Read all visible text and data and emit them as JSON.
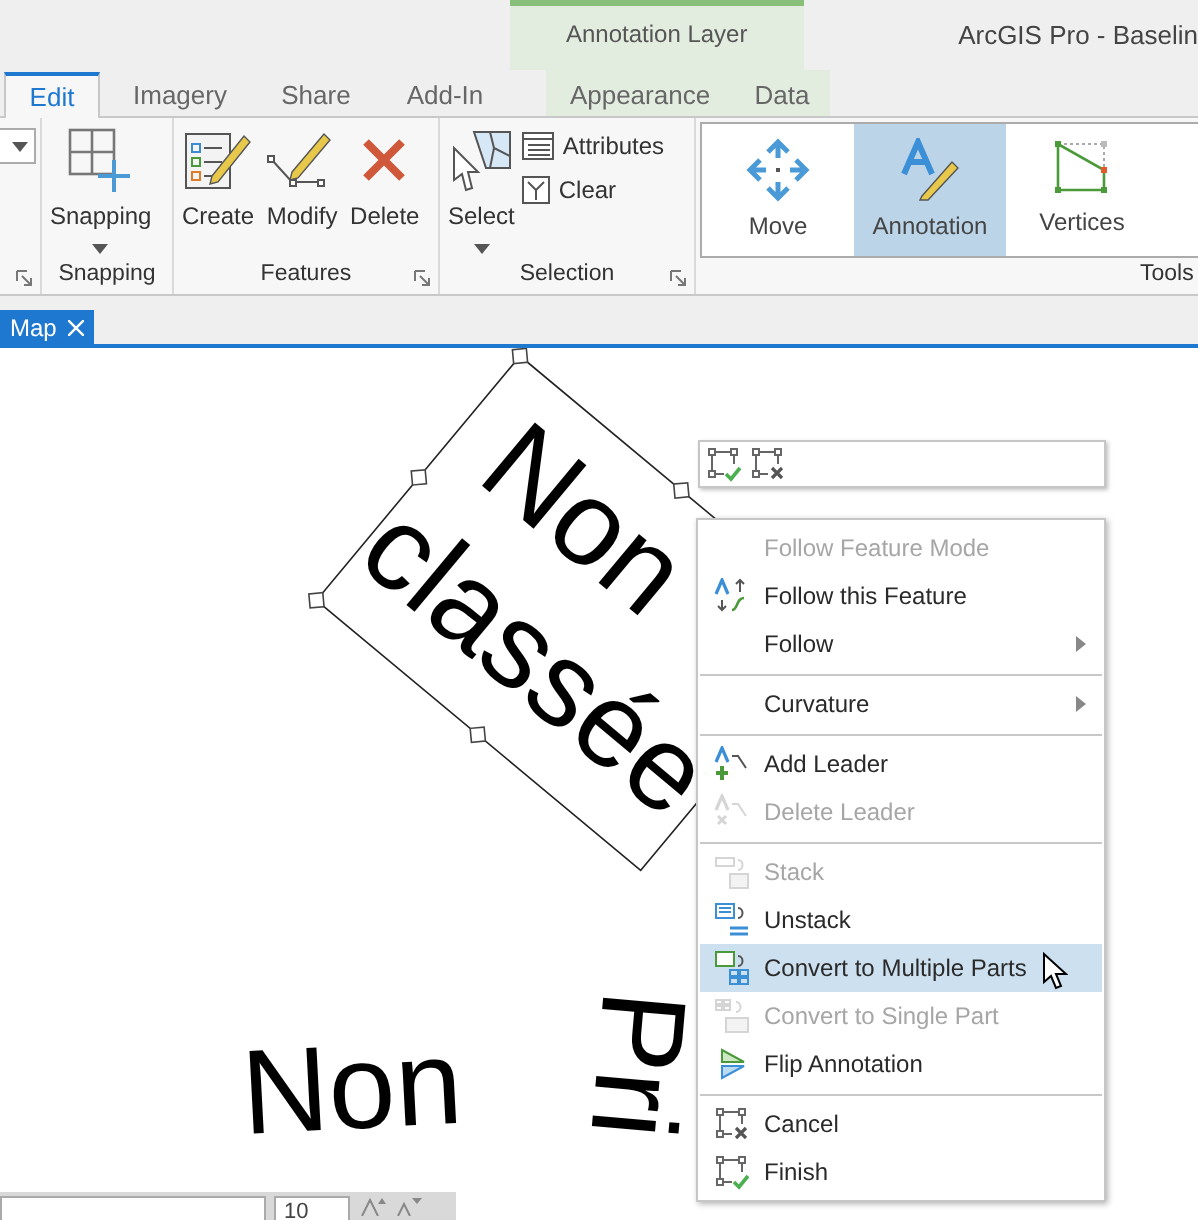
{
  "window": {
    "title": "ArcGIS Pro - Baselin"
  },
  "contextual_tab_group": {
    "label": "Annotation Layer"
  },
  "tabs": [
    {
      "label": "Edit",
      "selected": true,
      "contextual": false
    },
    {
      "label": "Imagery",
      "selected": false,
      "contextual": false
    },
    {
      "label": "Share",
      "selected": false,
      "contextual": false
    },
    {
      "label": "Add-In",
      "selected": false,
      "contextual": false
    },
    {
      "label": "Appearance",
      "selected": false,
      "contextual": true
    },
    {
      "label": "Data",
      "selected": false,
      "contextual": true
    }
  ],
  "ribbon_groups": [
    {
      "kind": "cut",
      "launcher": true,
      "buttons": [
        {
          "kind": "combo"
        }
      ]
    },
    {
      "kind": "group",
      "label": "Snapping",
      "launcher": false,
      "buttons": [
        {
          "kind": "large",
          "label": "Snapping",
          "dropdown": true
        }
      ]
    },
    {
      "kind": "group",
      "label": "Features",
      "launcher": true,
      "buttons": [
        {
          "kind": "large",
          "label": "Create",
          "dropdown": false
        },
        {
          "kind": "large",
          "label": "Modify",
          "dropdown": false
        },
        {
          "kind": "large",
          "label": "Delete",
          "dropdown": false
        }
      ]
    },
    {
      "kind": "group",
      "label": "Selection",
      "launcher": true,
      "buttons": [
        {
          "kind": "large",
          "label": "Select",
          "dropdown": true
        },
        {
          "kind": "small",
          "label": "Attributes"
        },
        {
          "kind": "small",
          "label": "Clear"
        }
      ]
    },
    {
      "kind": "gallery",
      "label": "Tools",
      "launcher": false,
      "buttons": [
        {
          "kind": "tile",
          "label": "Move",
          "selected": false
        },
        {
          "kind": "tile",
          "label": "Annotation",
          "selected": true
        },
        {
          "kind": "tile",
          "label": "Vertices",
          "selected": false
        }
      ]
    }
  ],
  "view_tabs": [
    {
      "label": "Map",
      "selected": true
    }
  ],
  "map": {
    "annotations": [
      {
        "lines": [
          "Non",
          "classée"
        ],
        "selected": true
      },
      {
        "lines": [
          "Non"
        ],
        "selected": false
      },
      {
        "lines": [
          "Pri"
        ],
        "selected": false
      }
    ]
  },
  "context_menu": [
    {
      "kind": "item",
      "label": "Follow Feature Mode",
      "disabled": true,
      "submenu": false,
      "selected": false
    },
    {
      "kind": "item",
      "label": "Follow this Feature",
      "disabled": false,
      "submenu": false,
      "selected": false
    },
    {
      "kind": "item",
      "label": "Follow",
      "disabled": false,
      "submenu": true,
      "selected": false
    },
    {
      "kind": "separator"
    },
    {
      "kind": "item",
      "label": "Curvature",
      "disabled": false,
      "submenu": true,
      "selected": false
    },
    {
      "kind": "separator"
    },
    {
      "kind": "item",
      "label": "Add Leader",
      "disabled": false,
      "submenu": false,
      "selected": false
    },
    {
      "kind": "item",
      "label": "Delete Leader",
      "disabled": true,
      "submenu": false,
      "selected": false
    },
    {
      "kind": "separator"
    },
    {
      "kind": "item",
      "label": "Stack",
      "disabled": true,
      "submenu": false,
      "selected": false
    },
    {
      "kind": "item",
      "label": "Unstack",
      "disabled": false,
      "submenu": false,
      "selected": false
    },
    {
      "kind": "item",
      "label": "Convert to Multiple Parts",
      "disabled": false,
      "submenu": false,
      "selected": true
    },
    {
      "kind": "item",
      "label": "Convert to Single Part",
      "disabled": true,
      "submenu": false,
      "selected": false
    },
    {
      "kind": "item",
      "label": "Flip Annotation",
      "disabled": false,
      "submenu": false,
      "selected": false
    },
    {
      "kind": "separator"
    },
    {
      "kind": "item",
      "label": "Cancel",
      "disabled": false,
      "submenu": false,
      "selected": false
    },
    {
      "kind": "item",
      "label": "Finish",
      "disabled": false,
      "submenu": false,
      "selected": false
    }
  ],
  "bottom_toolbar": {
    "font_size_value": "10"
  }
}
